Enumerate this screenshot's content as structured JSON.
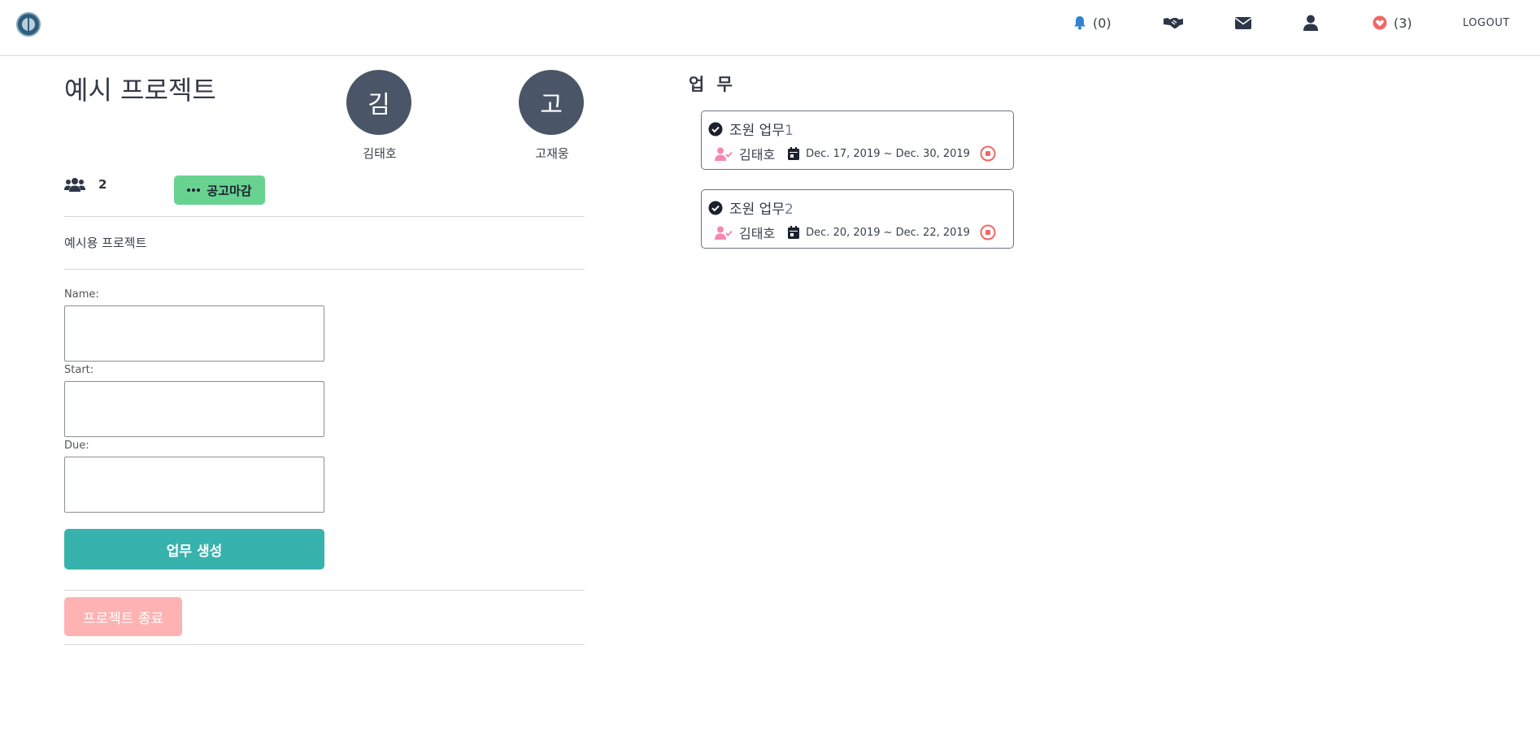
{
  "nav": {
    "notifications_count": "(0)",
    "likes_count": "(3)",
    "logout_label": "LOGOUT"
  },
  "project": {
    "title": "예시 프로젝트",
    "member_count": "2",
    "recruit_label": "공고마감",
    "description": "예시용 프로젝트",
    "members": [
      {
        "initial": "김",
        "name": "김태호"
      },
      {
        "initial": "고",
        "name": "고재웅"
      }
    ]
  },
  "form": {
    "name_label": "Name:",
    "start_label": "Start:",
    "due_label": "Due:",
    "name_value": "",
    "start_value": "",
    "due_value": "",
    "create_button": "업무 생성",
    "end_project_button": "프로젝트 종료"
  },
  "tasks": {
    "heading": "업 무",
    "items": [
      {
        "title": "조원 업무",
        "number": "1",
        "owner": "김태호",
        "dates": "Dec. 17, 2019 ~ Dec. 30, 2019"
      },
      {
        "title": "조원 업무",
        "number": "2",
        "owner": "김태호",
        "dates": "Dec. 20, 2019 ~ Dec. 22, 2019"
      }
    ]
  },
  "colors": {
    "accent_teal": "#38b2ac",
    "badge_green": "#68d391",
    "end_button_pink": "#feb2b2",
    "avatar_gray": "#4a5568",
    "bell_blue": "#3182ce",
    "heart_red": "#f56565"
  },
  "icons": {
    "logo": "logo-icon",
    "bell": "bell-icon",
    "handshake": "handshake-icon",
    "envelope": "envelope-icon",
    "user": "user-icon",
    "heart": "heart-icon",
    "users": "users-icon",
    "check": "check-circle-icon",
    "user_check": "user-check-icon",
    "calendar": "calendar-icon",
    "stop": "stop-circle-icon"
  }
}
